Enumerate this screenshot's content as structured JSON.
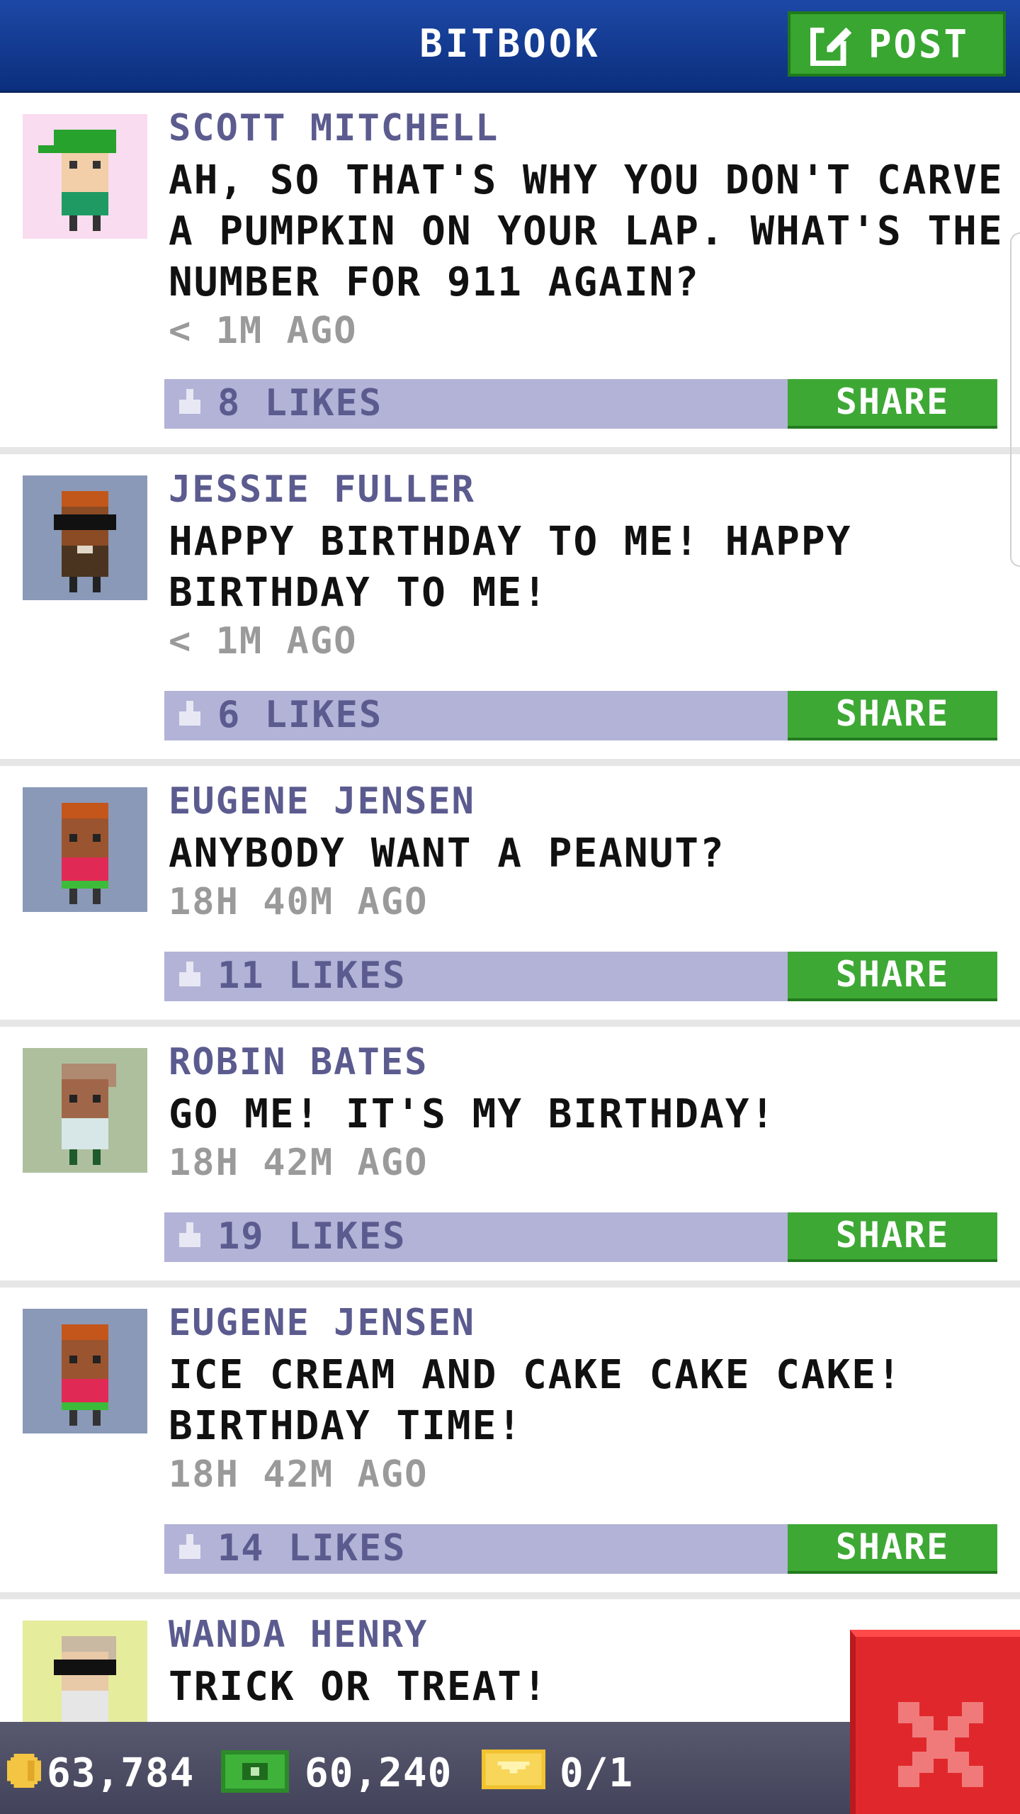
{
  "header": {
    "title": "BITBOOK",
    "post_label": "POST"
  },
  "posts": [
    {
      "author": "SCOTT MITCHELL",
      "message": "AH, SO THAT'S WHY YOU DON'T CARVE A PUMPKIN ON YOUR LAP. WHAT'S THE NUMBER FOR 911 AGAIN?",
      "time": "< 1M AGO",
      "likes": "8 LIKES",
      "share": "SHARE",
      "avatar_bg": "#f9dcef"
    },
    {
      "author": "JESSIE FULLER",
      "message": "HAPPY BIRTHDAY TO ME! HAPPY BIRTHDAY TO ME!",
      "time": "< 1M AGO",
      "likes": "6 LIKES",
      "share": "SHARE",
      "avatar_bg": "#8a99b8"
    },
    {
      "author": "EUGENE JENSEN",
      "message": "ANYBODY WANT A PEANUT?",
      "time": "18H 40M AGO",
      "likes": "11 LIKES",
      "share": "SHARE",
      "avatar_bg": "#8a99b8"
    },
    {
      "author": "ROBIN BATES",
      "message": "GO ME! IT'S MY BIRTHDAY!",
      "time": "18H 42M AGO",
      "likes": "19 LIKES",
      "share": "SHARE",
      "avatar_bg": "#aebf9e"
    },
    {
      "author": "EUGENE JENSEN",
      "message": "ICE CREAM AND CAKE CAKE CAKE! BIRTHDAY TIME!",
      "time": "18H 42M AGO",
      "likes": "14 LIKES",
      "share": "SHARE",
      "avatar_bg": "#8a99b8"
    },
    {
      "author": "WANDA HENRY",
      "message": "TRICK OR TREAT!",
      "avatar_bg": "#e5ec9c"
    }
  ],
  "status": {
    "coins": "63,784",
    "bux": "60,240",
    "tickets": "0/1"
  },
  "colors": {
    "header": "#1d48a6",
    "post_button": "#38a630",
    "like_bar": "#b2b3d6",
    "share_button": "#3ea835",
    "close_button": "#e0282c"
  },
  "icons": [
    "edit-icon",
    "thumbs-up-icon",
    "coin-icon",
    "bux-icon",
    "ticket-icon",
    "close-icon"
  ]
}
